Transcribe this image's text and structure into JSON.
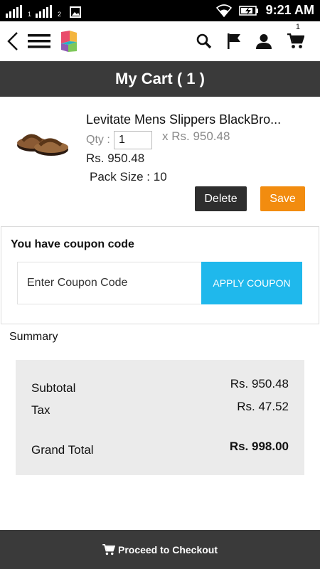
{
  "status_bar": {
    "sim1": "1",
    "sim2": "2",
    "time": "9:21 AM"
  },
  "app_bar": {
    "icons": [
      "back-icon",
      "menu-icon",
      "app-logo",
      "search-icon",
      "flag-icon",
      "user-icon",
      "cart-icon"
    ],
    "cart_badge": "1"
  },
  "title": "My Cart ( 1 )",
  "cart_item": {
    "name": "Levitate Mens Slippers BlackBro...",
    "qty_label": "Qty :",
    "qty_value": "1",
    "unit_price": "x Rs. 950.48",
    "line_price": "Rs. 950.48",
    "pack_size": "Pack Size : 10",
    "delete_label": "Delete",
    "save_label": "Save"
  },
  "coupon": {
    "title": "You have coupon code",
    "placeholder": "Enter Coupon Code",
    "apply_label": "APPLY COUPON"
  },
  "summary": {
    "label": "Summary",
    "subtotal_label": "Subtotal",
    "subtotal_value": "Rs. 950.48",
    "tax_label": "Tax",
    "tax_value": "Rs. 47.52",
    "grand_total_label": "Grand Total",
    "grand_total_value": "Rs. 998.00"
  },
  "checkout": {
    "label": "Proceed to Checkout"
  },
  "colors": {
    "header_dark": "#3a3a3a",
    "save_orange": "#f28c0f",
    "coupon_blue": "#1fb8ec",
    "summary_bg": "#ebebeb"
  }
}
